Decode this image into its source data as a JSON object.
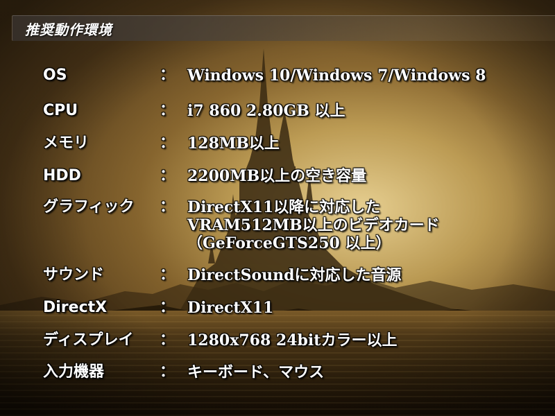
{
  "header": {
    "title": "推奨動作環境"
  },
  "specs": [
    {
      "label": "OS",
      "colon": "：",
      "lines": [
        "Windows 10/Windows 7/Windows 8"
      ]
    },
    {
      "label": "CPU",
      "colon": "：",
      "lines": [
        "i7 860 2.80GB 以上"
      ]
    },
    {
      "label": "メモリ",
      "colon": "：",
      "lines": [
        "128MB以上"
      ]
    },
    {
      "label": "HDD",
      "colon": "：",
      "lines": [
        "2200MB以上の空き容量"
      ]
    },
    {
      "label": "グラフィック",
      "colon": "：",
      "lines": [
        "DirectX11以降に対応した",
        "VRAM512MB以上のビデオカード",
        "（GeForceGTS250 以上）"
      ]
    },
    {
      "label": "サウンド",
      "colon": "：",
      "lines": [
        "DirectSoundに対応した音源"
      ]
    },
    {
      "label": "DirectX",
      "colon": "：",
      "lines": [
        "DirectX11"
      ]
    },
    {
      "label": "ディスプレイ",
      "colon": "：",
      "lines": [
        "1280x768 24bitカラー以上"
      ]
    },
    {
      "label": "入力機器",
      "colon": "：",
      "lines": [
        "キーボード、マウス"
      ]
    }
  ]
}
